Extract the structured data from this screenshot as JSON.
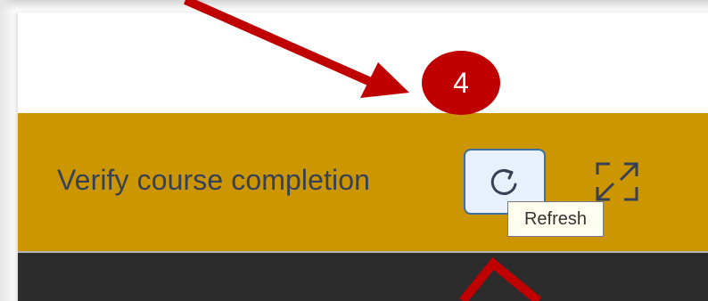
{
  "card": {
    "title": "Verify course completion"
  },
  "refresh_button": {
    "icon": "refresh-icon",
    "tooltip": "Refresh"
  },
  "expand_button": {
    "icon": "expand-icon"
  },
  "annotation": {
    "step_number": "4",
    "badge_color": "#c00000",
    "arrow_color": "#c00000"
  },
  "colors": {
    "header_bar": "#cc9600",
    "title_text": "#374055",
    "dark_bar": "#2c2c2c",
    "refresh_border": "#3a6ea8",
    "refresh_fill": "#e8f1fb"
  }
}
